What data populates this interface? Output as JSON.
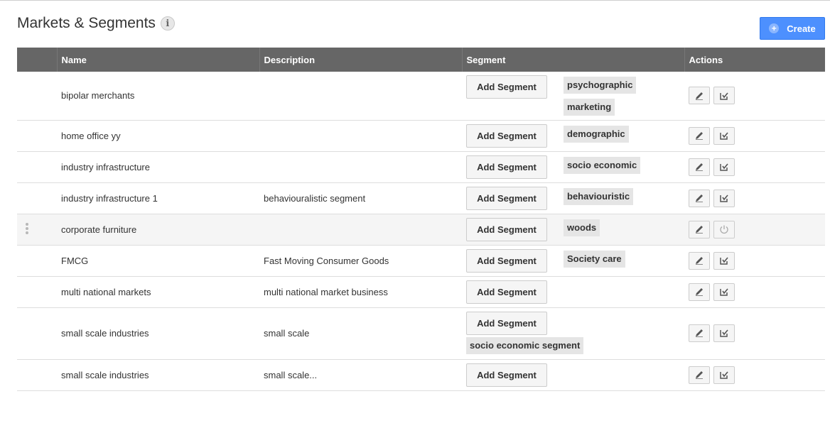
{
  "header": {
    "title": "Markets & Segments",
    "info_glyph": "i",
    "create_label": "Create",
    "create_icon": "plus-circle-icon"
  },
  "table": {
    "columns": [
      "",
      "Name",
      "Description",
      "Segment",
      "Actions"
    ],
    "add_segment_label": "Add Segment",
    "rows": [
      {
        "name": "bipolar merchants",
        "description": "",
        "segments": [
          "psychographic",
          "marketing"
        ],
        "second_action": "edit-target"
      },
      {
        "name": "home office yy",
        "description": "",
        "segments": [
          "demographic"
        ],
        "second_action": "edit-target"
      },
      {
        "name": "industry infrastructure",
        "description": "",
        "segments": [
          "socio economic"
        ],
        "second_action": "edit-target"
      },
      {
        "name": "industry infrastructure 1",
        "description": "behaviouralistic segment",
        "segments": [
          "behaviouristic"
        ],
        "second_action": "edit-target"
      },
      {
        "name": "corporate furniture",
        "description": "",
        "segments": [
          "woods"
        ],
        "second_action": "power",
        "highlighted": true
      },
      {
        "name": "FMCG",
        "description": "Fast Moving Consumer Goods",
        "segments": [
          "Society care"
        ],
        "second_action": "edit-target"
      },
      {
        "name": "multi national markets",
        "description": "multi national market business",
        "segments": [],
        "second_action": "edit-target"
      },
      {
        "name": "small scale industries",
        "description": "small scale",
        "segments": [
          "socio economic segment"
        ],
        "second_action": "edit-target"
      },
      {
        "name": "small scale industries",
        "description": "small scale...",
        "segments": [],
        "second_action": "edit-target"
      }
    ]
  },
  "colors": {
    "header_bg": "#666666",
    "accent": "#4d90fe",
    "tag_bg": "#e5e5e5"
  }
}
